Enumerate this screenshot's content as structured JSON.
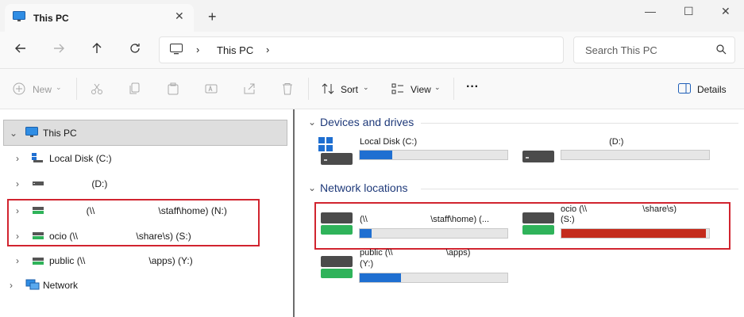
{
  "window": {
    "tab_title": "This PC",
    "tab_close": "✕",
    "new_tab": "+",
    "minimize": "—",
    "maximize": "☐",
    "close": "✕"
  },
  "address": {
    "breadcrumb_current": "This PC",
    "separator": "›",
    "search_placeholder": "Search This PC"
  },
  "toolbar": {
    "new_label": "New",
    "sort_label": "Sort",
    "view_label": "View",
    "more_label": "···",
    "details_label": "Details"
  },
  "nav_tree": [
    {
      "label": "This PC",
      "expanded": true,
      "selected": true
    },
    {
      "label": "Local Disk (C:)"
    },
    {
      "label": "                (D:)"
    },
    {
      "label": "              (\\\\                        \\staff\\home) (N:)"
    },
    {
      "label": "ocio (\\\\                      \\share\\s) (S:)"
    },
    {
      "label": "public (\\\\                        \\apps) (Y:)"
    },
    {
      "label": "Network"
    }
  ],
  "content": {
    "devices_header": "Devices and drives",
    "network_header": "Network locations",
    "devices": [
      {
        "name": "Local Disk (C:)",
        "fill": 0.22,
        "color": "#1f6fd1"
      },
      {
        "name": "                    (D:)",
        "fill": 0.0,
        "color": "#1f6fd1"
      }
    ],
    "network": [
      {
        "name_line1": "(\\\\                          \\staff\\home) (...",
        "name_line2": "",
        "fill": 0.08,
        "color": "#1f6fd1"
      },
      {
        "name_line1": "ocio (\\\\                       \\share\\s)",
        "name_line2": "(S:)",
        "fill": 0.98,
        "color": "#c42b1c"
      },
      {
        "name_line1": "public (\\\\                      \\apps)",
        "name_line2": "(Y:)",
        "fill": 0.28,
        "color": "#1f6fd1"
      }
    ]
  }
}
